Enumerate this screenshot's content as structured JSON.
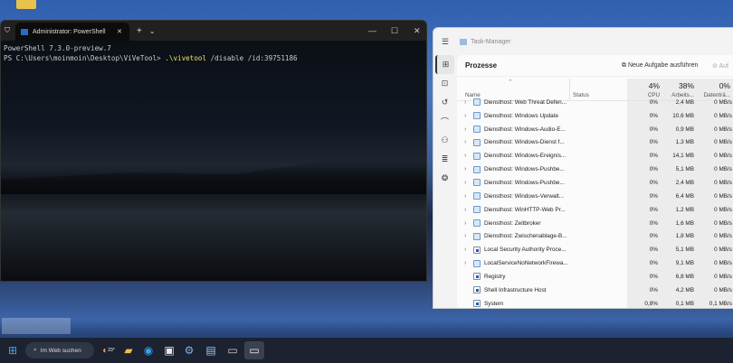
{
  "powershell": {
    "tab_title": "Administrator: PowerShell",
    "line1": "PowerShell 7.3.0-preview.7",
    "prompt": "PS C:\\Users\\moinmoin\\Desktop\\ViVeTool> ",
    "command": ".\\vivetool",
    "args": " /disable /id:39751186"
  },
  "taskmanager": {
    "title": "Task-Manager",
    "section": "Prozesse",
    "new_task": "Neue Aufgabe ausführen",
    "end_task": "Auf",
    "headers": {
      "name": "Name",
      "status": "Status",
      "cpu_pct": "4%",
      "cpu": "CPU",
      "mem_pct": "38%",
      "mem": "Arbeits...",
      "disk_pct": "0%",
      "disk": "Datenträ..."
    },
    "rows": [
      {
        "name": "Diensthost: Web Threat Defen...",
        "cpu": "0%",
        "mem": "2,4 MB",
        "disk": "0 MB/s",
        "type": "svc"
      },
      {
        "name": "Diensthost: Windows Update",
        "cpu": "0%",
        "mem": "10,6 MB",
        "disk": "0 MB/s",
        "type": "svc"
      },
      {
        "name": "Diensthost: Windows-Audio-E...",
        "cpu": "0%",
        "mem": "0,9 MB",
        "disk": "0 MB/s",
        "type": "svc"
      },
      {
        "name": "Diensthost: Windows-Dienst f...",
        "cpu": "0%",
        "mem": "1,3 MB",
        "disk": "0 MB/s",
        "type": "svc"
      },
      {
        "name": "Diensthost: Windows-Ereignis...",
        "cpu": "0%",
        "mem": "14,1 MB",
        "disk": "0 MB/s",
        "type": "svc"
      },
      {
        "name": "Diensthost: Windows-Pushbe...",
        "cpu": "0%",
        "mem": "5,1 MB",
        "disk": "0 MB/s",
        "type": "svc"
      },
      {
        "name": "Diensthost: Windows-Pushbe...",
        "cpu": "0%",
        "mem": "2,4 MB",
        "disk": "0 MB/s",
        "type": "svc"
      },
      {
        "name": "Diensthost: Windows-Verwalt...",
        "cpu": "0%",
        "mem": "6,4 MB",
        "disk": "0 MB/s",
        "type": "svc"
      },
      {
        "name": "Diensthost: WinHTTP-Web Pr...",
        "cpu": "0%",
        "mem": "1,2 MB",
        "disk": "0 MB/s",
        "type": "svc"
      },
      {
        "name": "Diensthost: Zeitbroker",
        "cpu": "0%",
        "mem": "1,6 MB",
        "disk": "0 MB/s",
        "type": "svc"
      },
      {
        "name": "Diensthost: Zwischenablage-B...",
        "cpu": "0%",
        "mem": "1,8 MB",
        "disk": "0 MB/s",
        "type": "svc"
      },
      {
        "name": "Local Security Authority Proce...",
        "cpu": "0%",
        "mem": "5,1 MB",
        "disk": "0 MB/s",
        "type": "app"
      },
      {
        "name": "LocalServiceNoNetworkFirewa...",
        "cpu": "0%",
        "mem": "9,1 MB",
        "disk": "0 MB/s",
        "type": "svc"
      },
      {
        "name": "Registry",
        "cpu": "0%",
        "mem": "6,8 MB",
        "disk": "0 MB/s",
        "type": "app",
        "leaf": true
      },
      {
        "name": "Shell Infrastructure Host",
        "cpu": "0%",
        "mem": "4,2 MB",
        "disk": "0 MB/s",
        "type": "app",
        "leaf": true
      },
      {
        "name": "System",
        "cpu": "0,8%",
        "mem": "0,1 MB",
        "disk": "0,1 MB/s",
        "type": "app",
        "leaf": true
      }
    ]
  },
  "taskbar": {
    "search": "Im Web suchen",
    "weather": "23°"
  }
}
